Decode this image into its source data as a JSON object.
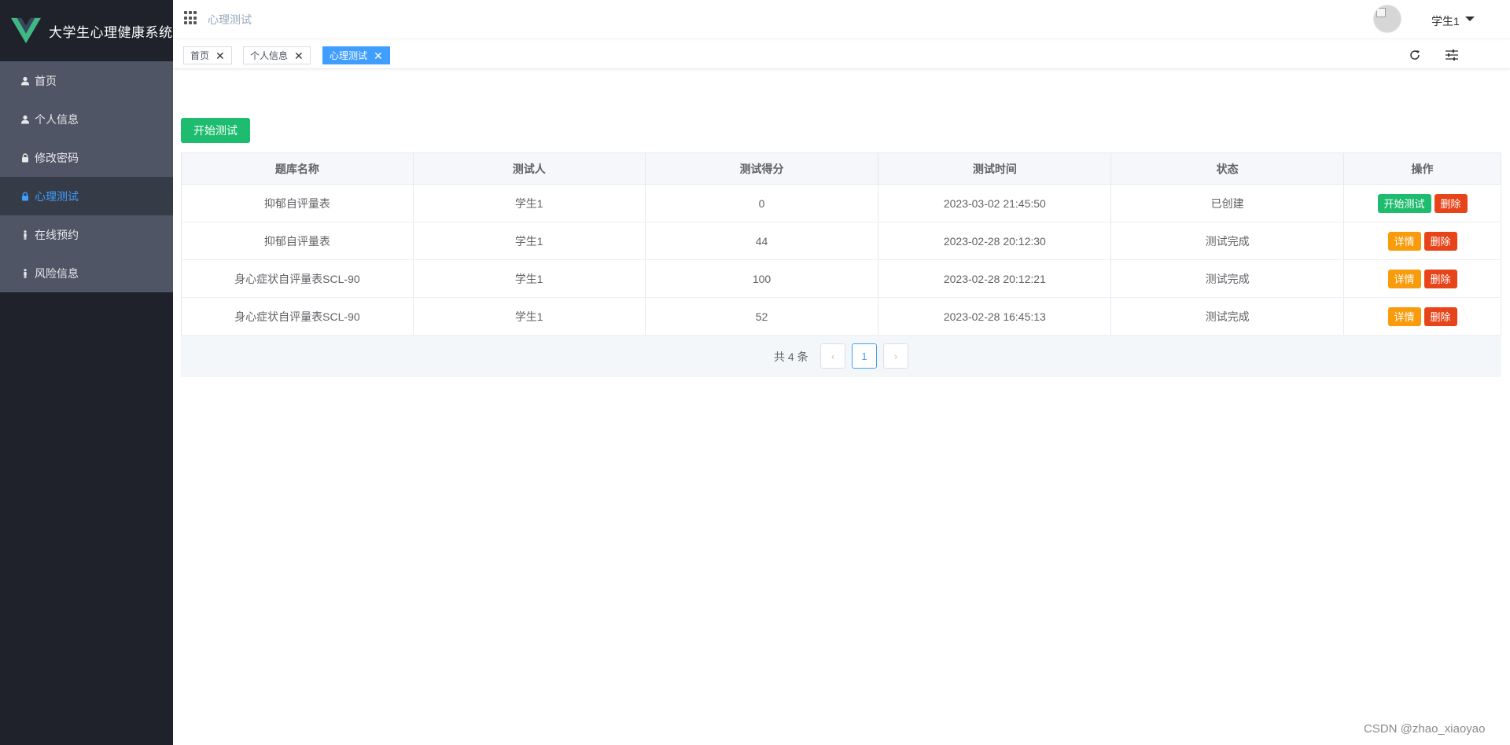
{
  "app": {
    "title": "大学生心理健康系统",
    "brand_color": "#41b883"
  },
  "sidebar": {
    "items": [
      {
        "label": "首页",
        "icon": "user-icon",
        "active": false
      },
      {
        "label": "个人信息",
        "icon": "user-icon",
        "active": false
      },
      {
        "label": "修改密码",
        "icon": "lock-icon",
        "active": false
      },
      {
        "label": "心理测试",
        "icon": "lock-icon",
        "active": true
      },
      {
        "label": "在线预约",
        "icon": "person-standing-icon",
        "active": false
      },
      {
        "label": "风险信息",
        "icon": "person-standing-icon",
        "active": false
      }
    ]
  },
  "header": {
    "breadcrumb": "心理测试",
    "user_name": "学生1"
  },
  "tags": [
    {
      "label": "首页",
      "active": false
    },
    {
      "label": "个人信息",
      "active": false
    },
    {
      "label": "心理测试",
      "active": true
    }
  ],
  "main": {
    "start_button": "开始测试",
    "table": {
      "headers": [
        "题库名称",
        "测试人",
        "测试得分",
        "测试时间",
        "状态",
        "操作"
      ],
      "rows": [
        {
          "name": "抑郁自评量表",
          "tester": "学生1",
          "score": "0",
          "time": "2023-03-02 21:45:50",
          "status": "已创建",
          "actions": [
            "开始测试",
            "删除"
          ]
        },
        {
          "name": "抑郁自评量表",
          "tester": "学生1",
          "score": "44",
          "time": "2023-02-28 20:12:30",
          "status": "测试完成",
          "actions": [
            "详情",
            "删除"
          ]
        },
        {
          "name": "身心症状自评量表SCL-90",
          "tester": "学生1",
          "score": "100",
          "time": "2023-02-28 20:12:21",
          "status": "测试完成",
          "actions": [
            "详情",
            "删除"
          ]
        },
        {
          "name": "身心症状自评量表SCL-90",
          "tester": "学生1",
          "score": "52",
          "time": "2023-02-28 16:45:13",
          "status": "测试完成",
          "actions": [
            "详情",
            "删除"
          ]
        }
      ]
    },
    "pagination": {
      "total_text": "共 4 条",
      "current_page": "1",
      "prev": "‹",
      "next": "›"
    }
  },
  "watermark": "CSDN @zhao_xiaoyao",
  "colors": {
    "primary": "#409eff",
    "success": "#1ebc6e",
    "danger": "#e8441a",
    "warning": "#f89c0e",
    "sidebar_bg": "#1f222b",
    "menu_bg": "#4f5565"
  }
}
